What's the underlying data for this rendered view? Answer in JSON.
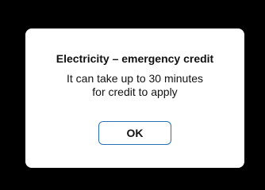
{
  "dialog": {
    "title": "Electricity – emergency credit",
    "message_lines": [
      "It can take up to 30 minutes",
      "for credit to apply"
    ],
    "ok_label": "OK"
  },
  "colors": {
    "background": "#000000",
    "dialog_background": "#ffffff",
    "button_border": "#2b6fb5",
    "text": "#111111"
  }
}
